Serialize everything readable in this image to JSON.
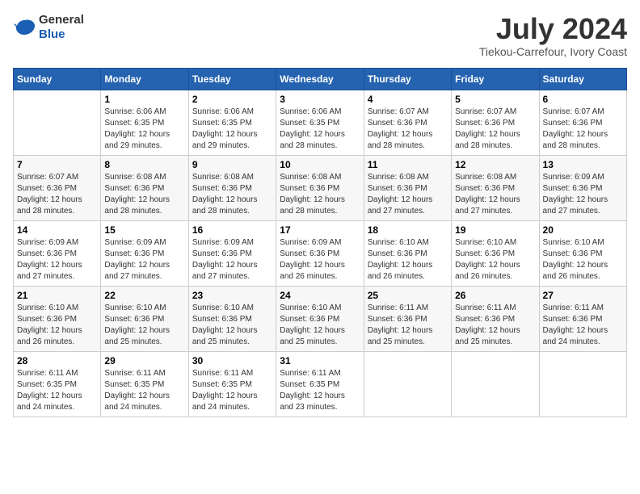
{
  "header": {
    "logo_general": "General",
    "logo_blue": "Blue",
    "month_title": "July 2024",
    "location": "Tiekou-Carrefour, Ivory Coast"
  },
  "days_of_week": [
    "Sunday",
    "Monday",
    "Tuesday",
    "Wednesday",
    "Thursday",
    "Friday",
    "Saturday"
  ],
  "weeks": [
    [
      {
        "num": "",
        "info": ""
      },
      {
        "num": "1",
        "info": "Sunrise: 6:06 AM\nSunset: 6:35 PM\nDaylight: 12 hours\nand 29 minutes."
      },
      {
        "num": "2",
        "info": "Sunrise: 6:06 AM\nSunset: 6:35 PM\nDaylight: 12 hours\nand 29 minutes."
      },
      {
        "num": "3",
        "info": "Sunrise: 6:06 AM\nSunset: 6:35 PM\nDaylight: 12 hours\nand 28 minutes."
      },
      {
        "num": "4",
        "info": "Sunrise: 6:07 AM\nSunset: 6:36 PM\nDaylight: 12 hours\nand 28 minutes."
      },
      {
        "num": "5",
        "info": "Sunrise: 6:07 AM\nSunset: 6:36 PM\nDaylight: 12 hours\nand 28 minutes."
      },
      {
        "num": "6",
        "info": "Sunrise: 6:07 AM\nSunset: 6:36 PM\nDaylight: 12 hours\nand 28 minutes."
      }
    ],
    [
      {
        "num": "7",
        "info": "Sunrise: 6:07 AM\nSunset: 6:36 PM\nDaylight: 12 hours\nand 28 minutes."
      },
      {
        "num": "8",
        "info": "Sunrise: 6:08 AM\nSunset: 6:36 PM\nDaylight: 12 hours\nand 28 minutes."
      },
      {
        "num": "9",
        "info": "Sunrise: 6:08 AM\nSunset: 6:36 PM\nDaylight: 12 hours\nand 28 minutes."
      },
      {
        "num": "10",
        "info": "Sunrise: 6:08 AM\nSunset: 6:36 PM\nDaylight: 12 hours\nand 28 minutes."
      },
      {
        "num": "11",
        "info": "Sunrise: 6:08 AM\nSunset: 6:36 PM\nDaylight: 12 hours\nand 27 minutes."
      },
      {
        "num": "12",
        "info": "Sunrise: 6:08 AM\nSunset: 6:36 PM\nDaylight: 12 hours\nand 27 minutes."
      },
      {
        "num": "13",
        "info": "Sunrise: 6:09 AM\nSunset: 6:36 PM\nDaylight: 12 hours\nand 27 minutes."
      }
    ],
    [
      {
        "num": "14",
        "info": "Sunrise: 6:09 AM\nSunset: 6:36 PM\nDaylight: 12 hours\nand 27 minutes."
      },
      {
        "num": "15",
        "info": "Sunrise: 6:09 AM\nSunset: 6:36 PM\nDaylight: 12 hours\nand 27 minutes."
      },
      {
        "num": "16",
        "info": "Sunrise: 6:09 AM\nSunset: 6:36 PM\nDaylight: 12 hours\nand 27 minutes."
      },
      {
        "num": "17",
        "info": "Sunrise: 6:09 AM\nSunset: 6:36 PM\nDaylight: 12 hours\nand 26 minutes."
      },
      {
        "num": "18",
        "info": "Sunrise: 6:10 AM\nSunset: 6:36 PM\nDaylight: 12 hours\nand 26 minutes."
      },
      {
        "num": "19",
        "info": "Sunrise: 6:10 AM\nSunset: 6:36 PM\nDaylight: 12 hours\nand 26 minutes."
      },
      {
        "num": "20",
        "info": "Sunrise: 6:10 AM\nSunset: 6:36 PM\nDaylight: 12 hours\nand 26 minutes."
      }
    ],
    [
      {
        "num": "21",
        "info": "Sunrise: 6:10 AM\nSunset: 6:36 PM\nDaylight: 12 hours\nand 26 minutes."
      },
      {
        "num": "22",
        "info": "Sunrise: 6:10 AM\nSunset: 6:36 PM\nDaylight: 12 hours\nand 25 minutes."
      },
      {
        "num": "23",
        "info": "Sunrise: 6:10 AM\nSunset: 6:36 PM\nDaylight: 12 hours\nand 25 minutes."
      },
      {
        "num": "24",
        "info": "Sunrise: 6:10 AM\nSunset: 6:36 PM\nDaylight: 12 hours\nand 25 minutes."
      },
      {
        "num": "25",
        "info": "Sunrise: 6:11 AM\nSunset: 6:36 PM\nDaylight: 12 hours\nand 25 minutes."
      },
      {
        "num": "26",
        "info": "Sunrise: 6:11 AM\nSunset: 6:36 PM\nDaylight: 12 hours\nand 25 minutes."
      },
      {
        "num": "27",
        "info": "Sunrise: 6:11 AM\nSunset: 6:36 PM\nDaylight: 12 hours\nand 24 minutes."
      }
    ],
    [
      {
        "num": "28",
        "info": "Sunrise: 6:11 AM\nSunset: 6:35 PM\nDaylight: 12 hours\nand 24 minutes."
      },
      {
        "num": "29",
        "info": "Sunrise: 6:11 AM\nSunset: 6:35 PM\nDaylight: 12 hours\nand 24 minutes."
      },
      {
        "num": "30",
        "info": "Sunrise: 6:11 AM\nSunset: 6:35 PM\nDaylight: 12 hours\nand 24 minutes."
      },
      {
        "num": "31",
        "info": "Sunrise: 6:11 AM\nSunset: 6:35 PM\nDaylight: 12 hours\nand 23 minutes."
      },
      {
        "num": "",
        "info": ""
      },
      {
        "num": "",
        "info": ""
      },
      {
        "num": "",
        "info": ""
      }
    ]
  ]
}
